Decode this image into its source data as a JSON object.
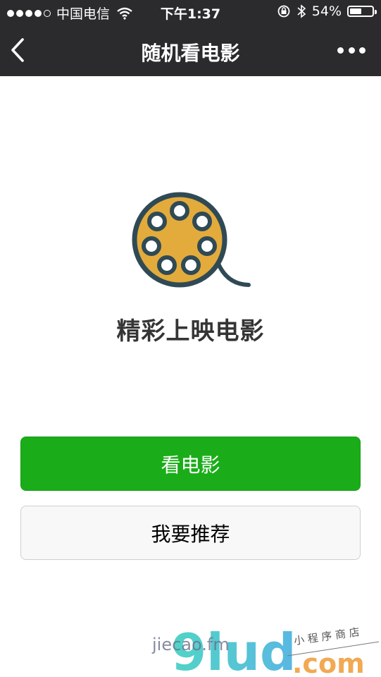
{
  "status_bar": {
    "carrier": "中国电信",
    "time": "下午1:37",
    "battery_percent": "54%",
    "battery_level": 0.54,
    "signal_bars_filled": 4,
    "signal_bars_total": 5,
    "icons": [
      "signal-dots-icon",
      "wifi-icon",
      "orientation-lock-icon",
      "bluetooth-icon",
      "battery-icon"
    ]
  },
  "nav": {
    "title": "随机看电影",
    "back_icon": "chevron-left-icon",
    "more_icon": "more-dots-icon"
  },
  "hero": {
    "icon": "film-reel-icon",
    "headline": "精彩上映电影",
    "colors": {
      "reel_fill": "#e3ab3c",
      "reel_outline": "#2f4a55"
    }
  },
  "actions": {
    "watch_label": "看电影",
    "recommend_label": "我要推荐"
  },
  "colors": {
    "bar_bg": "#2b2b2e",
    "primary_button": "#1aad19",
    "secondary_button": "#f8f8f8"
  },
  "watermark": {
    "text": "jiecao.fm",
    "logo_word": "9lud",
    "logo_suffix": ".com",
    "logo_caption": "小 程 序 商 店"
  }
}
